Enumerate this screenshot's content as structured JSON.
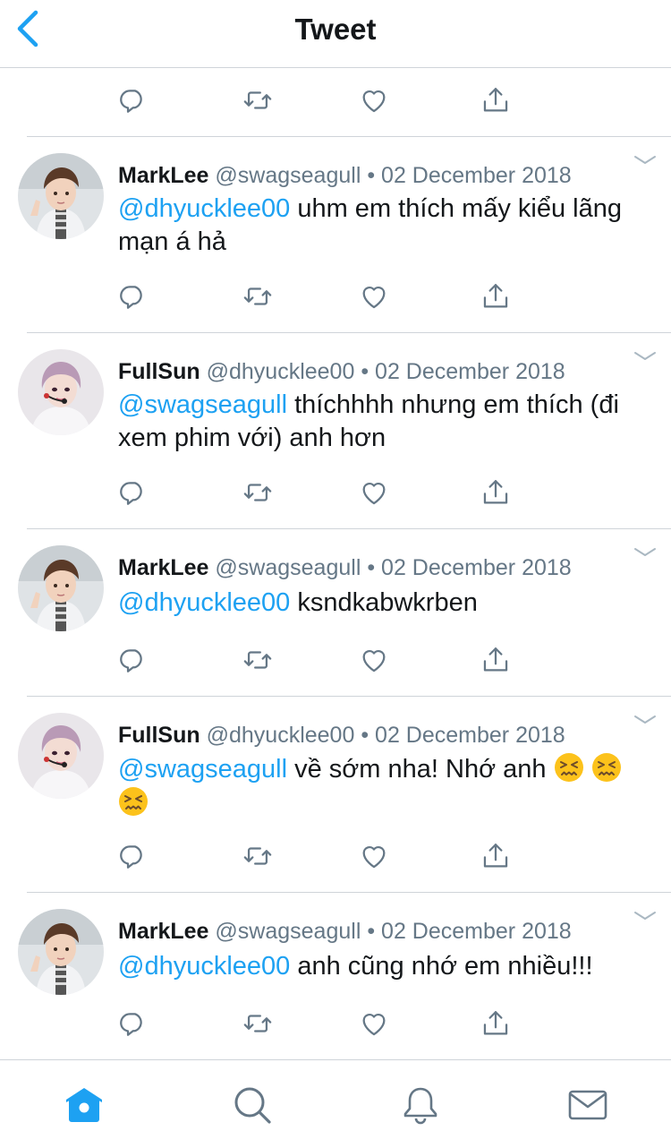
{
  "header": {
    "title": "Tweet"
  },
  "colors": {
    "accent": "#1da1f2",
    "icon": "#657786",
    "text": "#14171a",
    "divider": "#cfd4d9"
  },
  "tweets": [
    {
      "name": "MarkLee",
      "handle": "@swagseagull",
      "dot": "•",
      "date": "02 December 2018",
      "mention": "@dhyucklee00",
      "text": " uhm em thích mấy kiểu lãng mạn á hả",
      "avatar": "marklee-avatar"
    },
    {
      "name": "FullSun",
      "handle": "@dhyucklee00",
      "dot": "•",
      "date": "02 December 2018",
      "mention": "@swagseagull",
      "text": " thíchhhh nhưng em thích (đi xem phim với) anh hơn",
      "avatar": "fullsun-avatar"
    },
    {
      "name": "MarkLee",
      "handle": "@swagseagull",
      "dot": "•",
      "date": "02 December 2018",
      "mention": "@dhyucklee00",
      "text": " ksndkabwkrben",
      "avatar": "marklee-avatar"
    },
    {
      "name": "FullSun",
      "handle": "@dhyucklee00",
      "dot": "•",
      "date": "02 December 2018",
      "mention": "@swagseagull",
      "text": " về sớm nha! Nhớ anh ",
      "emoji": "confounded-face-emoji",
      "emoji_count": 3,
      "avatar": "fullsun-avatar"
    },
    {
      "name": "MarkLee",
      "handle": "@swagseagull",
      "dot": "•",
      "date": "02 December 2018",
      "mention": "@dhyucklee00",
      "text": " anh cũng nhớ em nhiều!!!",
      "avatar": "marklee-avatar"
    }
  ],
  "actions": [
    "reply-icon",
    "retweet-icon",
    "like-icon",
    "share-icon"
  ],
  "tabbar": [
    "home-icon",
    "search-icon",
    "notifications-icon",
    "messages-icon"
  ],
  "active_tab": "home-icon"
}
